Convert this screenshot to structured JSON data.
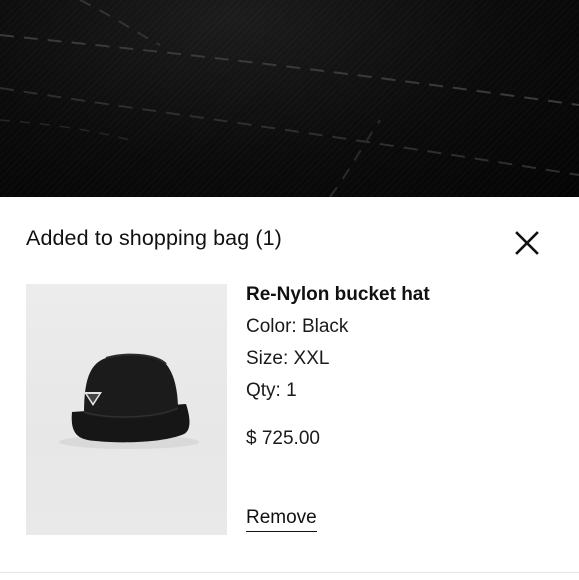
{
  "drawer": {
    "title": "Added to shopping bag (1)",
    "close_icon": "close-icon"
  },
  "product": {
    "name": "Re-Nylon bucket hat",
    "color": "Color: Black",
    "size": "Size: XXL",
    "qty": "Qty: 1",
    "price": "$ 725.00",
    "image_icon": "bucket-hat-image"
  },
  "actions": {
    "remove_label": "Remove"
  },
  "colors": {
    "hero_background": "#0b0b0b",
    "drawer_background": "#ffffff",
    "text": "#111111",
    "image_background": "#ebebeb"
  }
}
